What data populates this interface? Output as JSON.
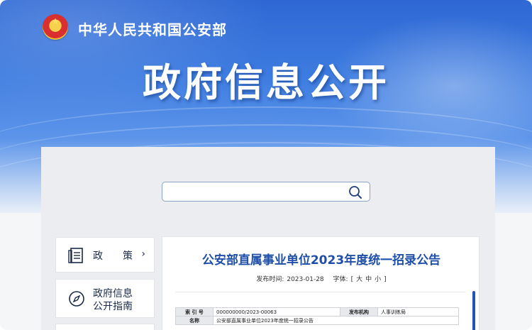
{
  "header": {
    "ministry": "中华人民共和国公安部",
    "title": "政府信息公开"
  },
  "search": {
    "placeholder": ""
  },
  "sidebar": {
    "items": [
      {
        "label": "政　　策",
        "icon": "document-list-icon",
        "chevron": "›"
      },
      {
        "label_line1": "政府信息",
        "label_line2": "公开指南",
        "icon": "compass-icon"
      }
    ]
  },
  "article": {
    "title": "公安部直属事业单位2023年度统一招录公告",
    "publish_label": "发布时间:",
    "publish_date": "2023-01-28",
    "font_label": "字体:",
    "font_open": "[",
    "font_large": "大",
    "font_medium": "中",
    "font_small": "小",
    "font_close": "]",
    "info_table": [
      {
        "k1": "索 引 号",
        "v1": "000000000/2023-00063",
        "k2": "发布机构",
        "v2": "人事训练局"
      },
      {
        "k1": "名称",
        "v1": "公安部直属事业单位2023年度统一招录公告",
        "k2": "",
        "v2": ""
      }
    ]
  },
  "colors": {
    "brand_blue": "#2f68d4",
    "title_blue": "#1f4fa8",
    "panel_gray": "#ebedf0"
  }
}
